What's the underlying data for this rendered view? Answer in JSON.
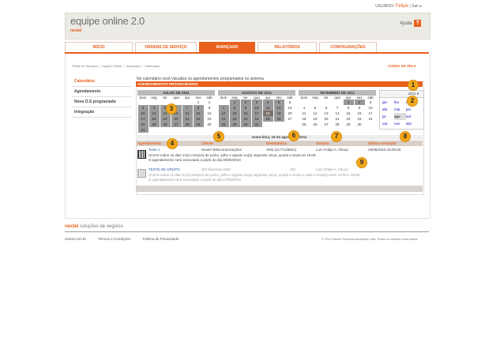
{
  "header": {
    "user_label": "USUÁRIO:",
    "user_name": "Felipe",
    "separator": "|",
    "logout": "Sair",
    "logout_arrow": "▸",
    "app_title": "equipe online 2.0",
    "brand": "nextel",
    "help": "Ajuda",
    "help_glyph": "?"
  },
  "nav": {
    "tabs": [
      {
        "label": "INÍCIO"
      },
      {
        "label": "ORDENS DE SERVIÇO"
      },
      {
        "label": "AVANÇADO"
      },
      {
        "label": "RELATÓRIOS"
      },
      {
        "label": "CONFIGURAÇÕES"
      }
    ]
  },
  "breadcrumb": {
    "items": [
      "Portal de Serviços",
      "Equipe Online",
      "Avançado",
      "Calendário"
    ],
    "separator": "/",
    "help_screen": "AJUDA NA TELA"
  },
  "sidebar": {
    "items": [
      {
        "label": "Calendário"
      },
      {
        "label": "Agendamento"
      },
      {
        "label": "Nova O.S programada"
      },
      {
        "label": "Integração"
      }
    ]
  },
  "main": {
    "intro": "No calendário você visualiza os agendamentos programados no sistema",
    "panel_title": "AGENDAMENTOS PROGRAMADOS",
    "weekday_headers": [
      "dom",
      "seg",
      "ter",
      "qua",
      "qui",
      "sex",
      "sáb"
    ],
    "calendars": [
      {
        "title": "JULHO DE 2011",
        "rows": [
          [
            "",
            "",
            "",
            "",
            "",
            "1",
            "2"
          ],
          [
            "3",
            "4",
            "5",
            "6",
            "7",
            "8",
            "9"
          ],
          [
            "10",
            "11",
            "12",
            "13",
            "14",
            "15",
            "16"
          ],
          [
            "17",
            "18",
            "19",
            "20",
            "21",
            "22",
            "23"
          ],
          [
            "24",
            "25",
            "26",
            "27",
            "28",
            "29",
            "30"
          ],
          [
            "31",
            "",
            "",
            "",
            "",
            "",
            ""
          ]
        ]
      },
      {
        "title": "AGOSTO DE 2011",
        "rows": [
          [
            "",
            "1",
            "2",
            "3",
            "4",
            "5",
            "6"
          ],
          [
            "7",
            "8",
            "9",
            "10",
            "11",
            "12",
            "13"
          ],
          [
            "14",
            "15",
            "16",
            "17",
            "18",
            "19",
            "20"
          ],
          [
            "21",
            "22",
            "23",
            "24",
            "25",
            "26",
            "27"
          ],
          [
            "28",
            "29",
            "30",
            "31",
            "",
            "",
            ""
          ]
        ]
      },
      {
        "title": "SETEMBRO DE 2011",
        "rows": [
          [
            "",
            "",
            "",
            "",
            "1",
            "2",
            "3"
          ],
          [
            "4",
            "5",
            "6",
            "7",
            "8",
            "9",
            "10"
          ],
          [
            "11",
            "12",
            "13",
            "14",
            "15",
            "16",
            "17"
          ],
          [
            "18",
            "19",
            "20",
            "21",
            "22",
            "23",
            "24"
          ],
          [
            "25",
            "26",
            "27",
            "28",
            "29",
            "30",
            ""
          ]
        ]
      }
    ],
    "month_picker": {
      "year": "2011",
      "months": [
        "jan",
        "fev",
        "mar",
        "abr",
        "mai",
        "jun",
        "jul",
        "ago",
        "set",
        "out",
        "nov",
        "dez"
      ]
    },
    "date_bar": "sexta-feira, 19 de agosto de 2011",
    "columns": [
      "Agendamento",
      "Cliente",
      "Destinatário",
      "Usuário",
      "Última execução"
    ],
    "rows": [
      {
        "name": "Teste 1",
        "client": "Nextel Telecomunicações",
        "recipient": "XM2 (1177128801)",
        "user": "Luiz Felipe A. Fleury",
        "last_run": "29/06/2010 15:00:00",
        "desc1": "Ocorre todos os dias no(s) mes(es) de junho, julho e agosto no(a) segunda, terça, quinta e sexta às 15:00.",
        "desc2": "O agendamento será executado a partir do dia 09/06/2010"
      },
      {
        "name": "TESTE DE GRUPO",
        "client": "XM Sistemas Distr",
        "recipient": "XM",
        "user": "Luiz Felipe A. Fleury",
        "last_run": "",
        "desc1": "Ocorre todos os dias no(s) mes(es) de junho, julho e agosto no(a) segunda, terça, quinta e sexta a cada 1 hora(s) entre 15:00 e 18:00.",
        "desc2": "O agendamento será executado a partir do dia 17/06/2010"
      }
    ],
    "badges": [
      "1",
      "2",
      "3",
      "4",
      "5",
      "6",
      "7",
      "8",
      "9"
    ]
  },
  "footer": {
    "logo": "nextel",
    "tagline": "soluções de negócio",
    "links": [
      "nextel.com.br",
      "Termos e Condições",
      "Política de Privacidade"
    ],
    "copyright": "© 2010 Nextel Telecomunicações Ltda. Todos os direitos reservados."
  },
  "colors": {
    "accent": "#e8601c",
    "badge": "#f2a81d"
  }
}
